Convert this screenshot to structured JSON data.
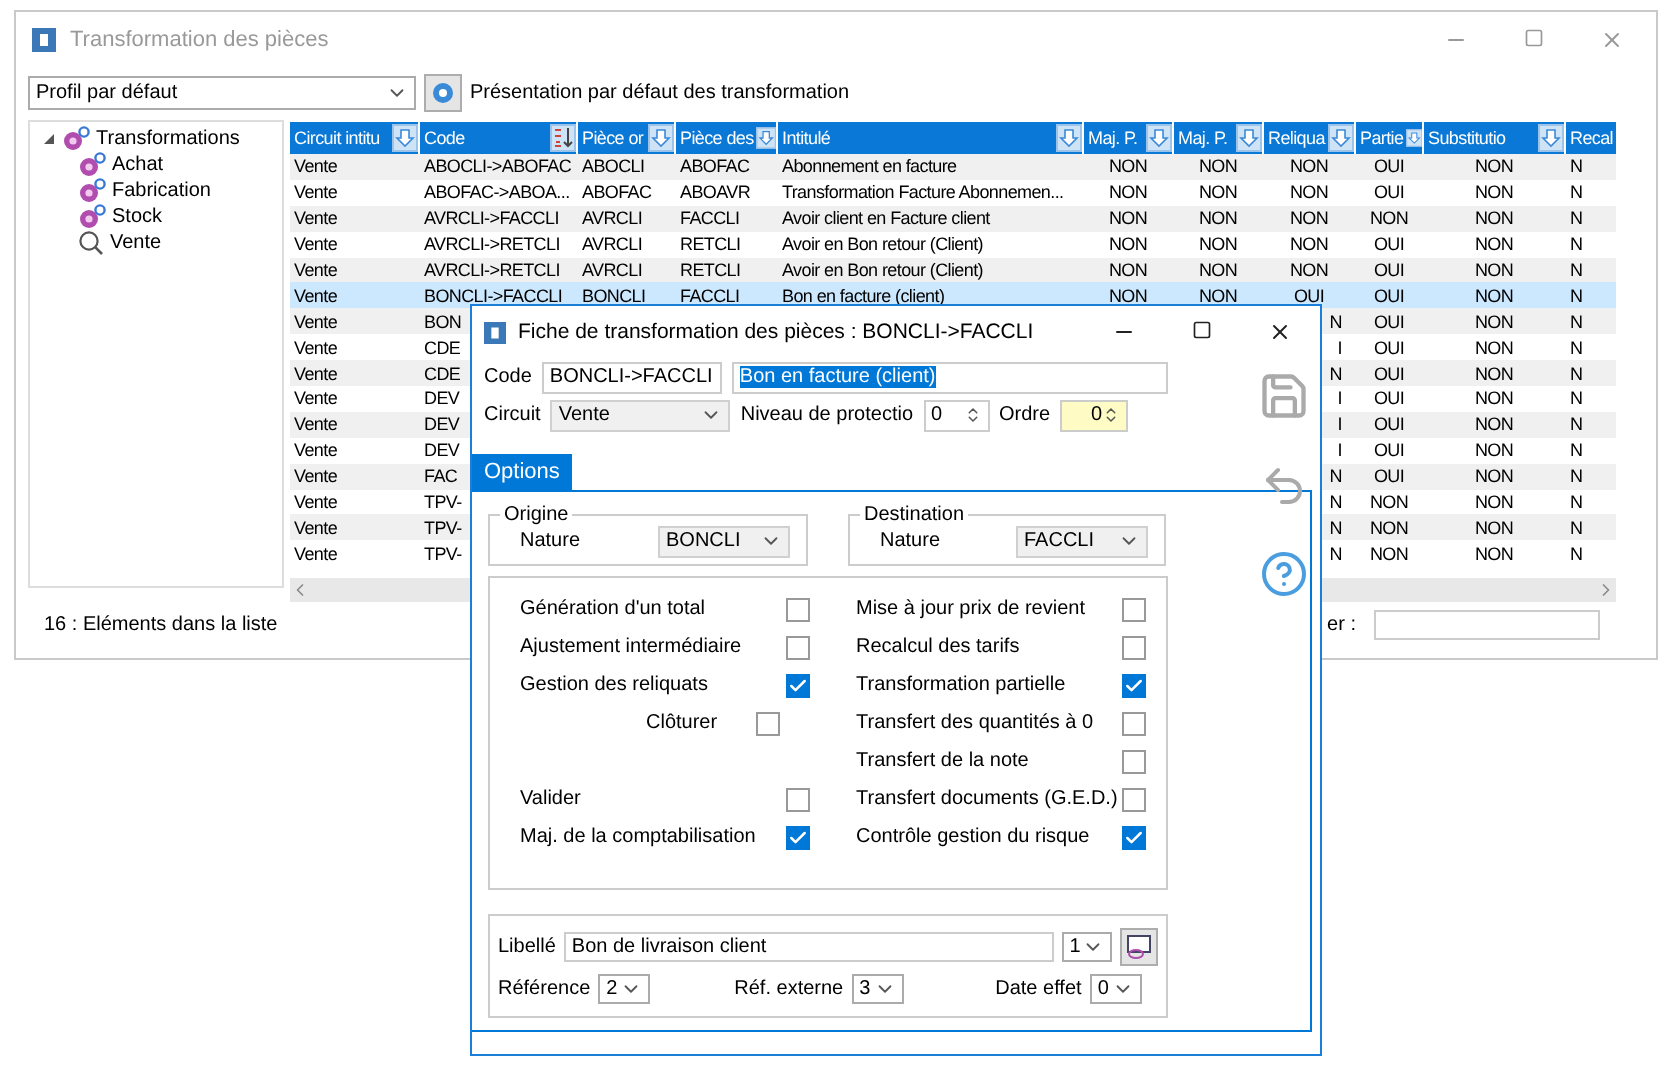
{
  "window": {
    "title": "Transformation des pièces"
  },
  "profile": {
    "value": "Profil par défaut"
  },
  "presentation": "Présentation par défaut des transformation",
  "tree": [
    {
      "label": "Transformations",
      "kind": "group",
      "expanded": true,
      "children": [
        {
          "label": "Achat",
          "kind": "group"
        },
        {
          "label": "Fabrication",
          "kind": "group"
        },
        {
          "label": "Stock",
          "kind": "group"
        },
        {
          "label": "Vente",
          "kind": "search"
        }
      ]
    }
  ],
  "table": {
    "columns": [
      {
        "label": "Circuit intitu"
      },
      {
        "label": "Code",
        "sorted": true
      },
      {
        "label": "Pièce or"
      },
      {
        "label": "Pièce des"
      },
      {
        "label": "Intitulé"
      },
      {
        "label": "Maj. P."
      },
      {
        "label": "Maj. P."
      },
      {
        "label": "Reliqua"
      },
      {
        "label": "Partie"
      },
      {
        "label": "Substitutio"
      },
      {
        "label": "Recal"
      }
    ],
    "rows": [
      {
        "selected": false,
        "covered": false,
        "cells": [
          "Vente",
          "ABOCLI->ABOFAC",
          "ABOCLI",
          "ABOFAC",
          "Abonnement en facture",
          "NON",
          "NON",
          "NON",
          "OUI",
          "NON",
          "N"
        ]
      },
      {
        "selected": false,
        "covered": false,
        "cells": [
          "Vente",
          "ABOFAC->ABOA...",
          "ABOFAC",
          "ABOAVR",
          "Transformation Facture Abonnemen...",
          "NON",
          "NON",
          "NON",
          "OUI",
          "NON",
          "N"
        ]
      },
      {
        "selected": false,
        "covered": false,
        "cells": [
          "Vente",
          "AVRCLI->FACCLI",
          "AVRCLI",
          "FACCLI",
          "Avoir client en Facture client",
          "NON",
          "NON",
          "NON",
          "NON",
          "NON",
          "N"
        ]
      },
      {
        "selected": false,
        "covered": false,
        "cells": [
          "Vente",
          "AVRCLI->RETCLI",
          "AVRCLI",
          "RETCLI",
          "Avoir en Bon retour (Client)",
          "NON",
          "NON",
          "NON",
          "OUI",
          "NON",
          "N"
        ]
      },
      {
        "selected": false,
        "covered": false,
        "cells": [
          "Vente",
          "AVRCLI->RETCLI",
          "AVRCLI",
          "RETCLI",
          "Avoir en Bon retour (Client)",
          "NON",
          "NON",
          "NON",
          "OUI",
          "NON",
          "N"
        ]
      },
      {
        "selected": true,
        "covered": false,
        "cells": [
          "Vente",
          "BONCLI->FACCLI",
          "BONCLI",
          "FACCLI",
          "Bon en facture (client)",
          "NON",
          "NON",
          "OUI",
          "OUI",
          "NON",
          "N"
        ]
      },
      {
        "selected": false,
        "covered": true,
        "cells": [
          "Vente",
          "BON",
          null,
          null,
          null,
          null,
          null,
          "N",
          "OUI",
          "NON",
          "N"
        ]
      },
      {
        "selected": false,
        "covered": true,
        "cells": [
          "Vente",
          "CDE",
          null,
          null,
          null,
          null,
          null,
          "I",
          "OUI",
          "NON",
          "N"
        ]
      },
      {
        "selected": false,
        "covered": true,
        "cells": [
          "Vente",
          "CDE",
          null,
          null,
          null,
          null,
          null,
          "N",
          "OUI",
          "NON",
          "N"
        ]
      },
      {
        "selected": false,
        "covered": true,
        "cells": [
          "Vente",
          "DEV",
          null,
          null,
          null,
          null,
          null,
          "I",
          "OUI",
          "NON",
          "N"
        ]
      },
      {
        "selected": false,
        "covered": true,
        "cells": [
          "Vente",
          "DEV",
          null,
          null,
          null,
          null,
          null,
          "I",
          "OUI",
          "NON",
          "N"
        ]
      },
      {
        "selected": false,
        "covered": true,
        "cells": [
          "Vente",
          "DEV",
          null,
          null,
          null,
          null,
          null,
          "I",
          "OUI",
          "NON",
          "N"
        ]
      },
      {
        "selected": false,
        "covered": true,
        "cells": [
          "Vente",
          "FAC",
          null,
          null,
          null,
          null,
          null,
          "N",
          "OUI",
          "NON",
          "N"
        ]
      },
      {
        "selected": false,
        "covered": true,
        "cells": [
          "Vente",
          "TPV-",
          null,
          null,
          null,
          null,
          null,
          "N",
          "NON",
          "NON",
          "N"
        ]
      },
      {
        "selected": false,
        "covered": true,
        "cells": [
          "Vente",
          "TPV-",
          null,
          null,
          null,
          null,
          null,
          "N",
          "NON",
          "NON",
          "N"
        ]
      },
      {
        "selected": false,
        "covered": true,
        "cells": [
          "Vente",
          "TPV-",
          null,
          null,
          null,
          null,
          null,
          "N",
          "NON",
          "NON",
          "N"
        ]
      }
    ]
  },
  "status_bar": {
    "count": "16 : Eléments dans la liste",
    "search_label": "er :"
  },
  "dialog": {
    "title": "Fiche de transformation des pièces : BONCLI->FACCLI",
    "code_label": "Code",
    "code": "BONCLI->FACCLI",
    "intitule": "Bon en facture (client)",
    "circuit_label": "Circuit",
    "circuit": "Vente",
    "protection_label": "Niveau de protectio",
    "protection": "0",
    "ordre_label": "Ordre",
    "ordre": "0",
    "tabs": [
      {
        "label": "Options",
        "selected": true
      }
    ],
    "origine": {
      "title": "Origine",
      "label": "Nature",
      "value": "BONCLI"
    },
    "destination": {
      "title": "Destination",
      "label": "Nature",
      "value": "FACCLI"
    },
    "left_options": [
      {
        "label": "Génération d'un total",
        "checked": false,
        "kind": "main"
      },
      {
        "label": "Ajustement intermédiaire",
        "checked": false,
        "kind": "main"
      },
      {
        "label": "Gestion des reliquats",
        "checked": true,
        "kind": "main"
      },
      {
        "label": "Clôturer",
        "checked": false,
        "kind": "sub"
      },
      {
        "label": "Valider",
        "checked": false,
        "kind": "spaced"
      },
      {
        "label": "Maj. de la comptabilisation",
        "checked": true,
        "kind": "main"
      }
    ],
    "right_options": [
      {
        "label": "Mise à jour prix de revient",
        "checked": false
      },
      {
        "label": "Recalcul des tarifs",
        "checked": false
      },
      {
        "label": "Transformation partielle",
        "checked": true
      },
      {
        "label": "Transfert des quantités à 0",
        "checked": false
      },
      {
        "label": "Transfert de la note",
        "checked": false
      },
      {
        "label": "Transfert documents (G.E.D.)",
        "checked": false
      },
      {
        "label": "Contrôle gestion du risque",
        "checked": true
      }
    ],
    "libelle_label": "Libellé",
    "libelle": "Bon de livraison client",
    "libelle_num": "1",
    "reference_label": "Référence",
    "reference": "2",
    "ref_externe_label": "Réf. externe",
    "ref_externe": "3",
    "date_effet_label": "Date effet",
    "date_effet": "0"
  }
}
